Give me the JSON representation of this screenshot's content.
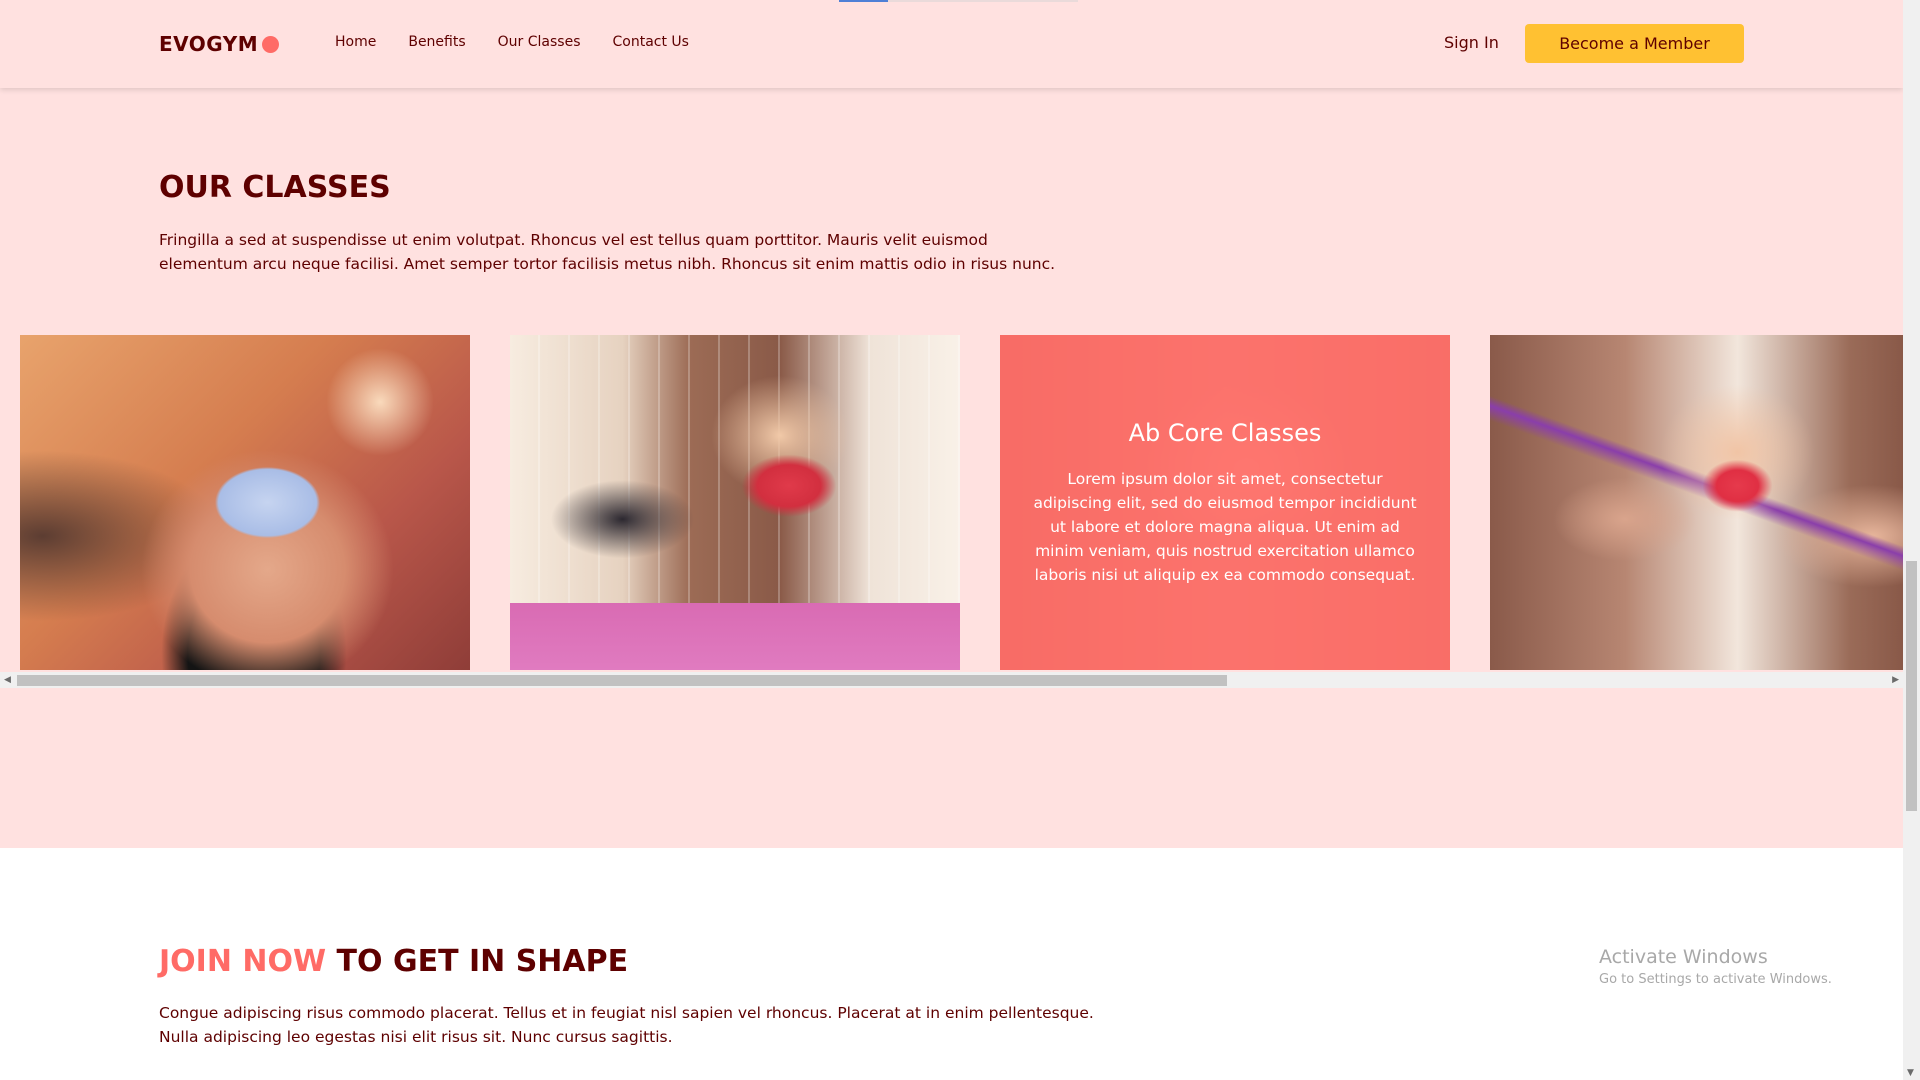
{
  "nav": {
    "logo": "EVOGYM",
    "links": [
      "Home",
      "Benefits",
      "Our Classes",
      "Contact Us"
    ],
    "sign_in": "Sign In",
    "cta": "Become a Member"
  },
  "classes": {
    "title": "OUR CLASSES",
    "description": "Fringilla a sed at suspendisse ut enim volutpat. Rhoncus vel est tellus quam porttitor. Mauris velit euismod elementum arcu neque facilisi. Amet semper tortor facilisis metus nibh. Rhoncus sit enim mattis odio in risus nunc.",
    "cards": [
      {
        "photo": "weight-training-photo"
      },
      {
        "photo": "yoga-class-photo"
      },
      {
        "photo": "ab-core-photo",
        "title": "Ab Core Classes",
        "description": "Lorem ipsum dolor sit amet, consectetur adipiscing elit, sed do eiusmod tempor incididunt ut labore et dolore magna aliqua. Ut enim ad minim veniam, quis nostrud exercitation ullamco laboris nisi ut aliquip ex ea commodo consequat."
      },
      {
        "photo": "resistance-band-photo"
      }
    ],
    "overlay_color": "#ff6b66"
  },
  "join": {
    "title_accent": "JOIN NOW",
    "title_rest": " TO GET IN SHAPE",
    "description": "Congue adipiscing risus commodo placerat. Tellus et in feugiat nisl sapien vel rhoncus. Placerat at in enim pellentesque. Nulla adipiscing leo egestas nisi elit risus sit. Nunc cursus sagittis."
  },
  "watermark": {
    "title": "Activate Windows",
    "subtitle": "Go to Settings to activate Windows."
  },
  "colors": {
    "primary_bg": "#ffe1e0",
    "dark_text": "#5e0000",
    "accent": "#ff6b66",
    "cta": "#ffc132"
  }
}
